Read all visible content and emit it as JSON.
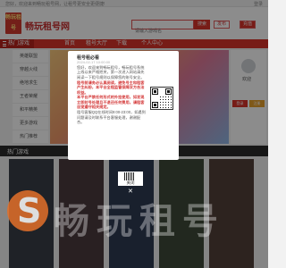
{
  "topbar": {
    "notice": "您好，欢迎来到畅玩租号网，让租号更安全更便捷!",
    "login": "登录"
  },
  "header": {
    "logo_text": "畅玩租号",
    "site_name": "畅玩租号网",
    "search_placeholder": "请输入游戏名",
    "search_button": "搜索",
    "publish_button": "发布",
    "recharge_button": "充值"
  },
  "nav": {
    "items": [
      "热门游戏",
      "首页",
      "租号大厅",
      "下载",
      "个人中心"
    ]
  },
  "sidebar": {
    "items": [
      "英雄联盟",
      "穿越火线",
      "绝地求生",
      "王者荣耀",
      "和平精英",
      "更多游戏",
      "热门推荐"
    ]
  },
  "right_panel": {
    "welcome": "欢迎",
    "login_button": "登录",
    "register_button": "注册"
  },
  "section": {
    "title": "热门游戏"
  },
  "modal": {
    "title": "租号租必看",
    "date": "2024-02-17 10:00:00",
    "paragraphs": [
      "您好，欢迎来到畅玩租号，畅玩租号系统上线以来严格把关，第一次进入网站请先阅读一下租号规则以保障您的账号安全。",
      "租号前请务必认真阅读，避免号主和租客产生纠纷，本平台全程监管保障双方合法权益。",
      "本平台严禁任何形式的外挂使用，如发现立即封号处理且不退还任何费用，请租客自觉遵守相关规定。",
      "租号客服QQ在线时间9:00-23:00，如遇到问题请及时联系平台客服处理，谢谢配合。"
    ],
    "red_paragraph_index": [
      1,
      2
    ],
    "close_label": "关闭",
    "close_icon": "close-icon"
  },
  "watermark": {
    "text": "畅玩租号"
  },
  "colors": {
    "brand_red": "#d9342b",
    "overlay": "rgba(0,0,0,0.45)"
  }
}
